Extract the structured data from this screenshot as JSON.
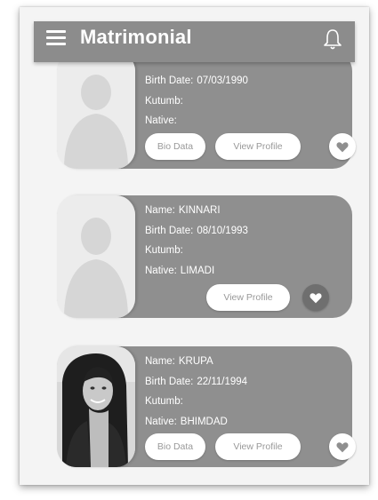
{
  "app": {
    "title": "Matrimonial"
  },
  "labels": {
    "name": "Name:",
    "birth_date": "Birth Date:",
    "kutumb": "Kutumb:",
    "native": "Native:",
    "bio_data": "Bio Data",
    "view_profile": "View Profile"
  },
  "profiles": [
    {
      "name": "",
      "birth_date": "07/03/1990",
      "kutumb": "",
      "native": "",
      "has_photo": false
    },
    {
      "name": "KINNARI",
      "birth_date": "08/10/1993",
      "kutumb": "",
      "native": "LIMADI",
      "has_photo": false
    },
    {
      "name": "KRUPA",
      "birth_date": "22/11/1994",
      "kutumb": "",
      "native": "BHIMDAD",
      "has_photo": true
    }
  ],
  "colors": {
    "appbar": "#8c8c8c",
    "card": "#8f8f8f",
    "favorite_active": "#6f6f6f"
  }
}
